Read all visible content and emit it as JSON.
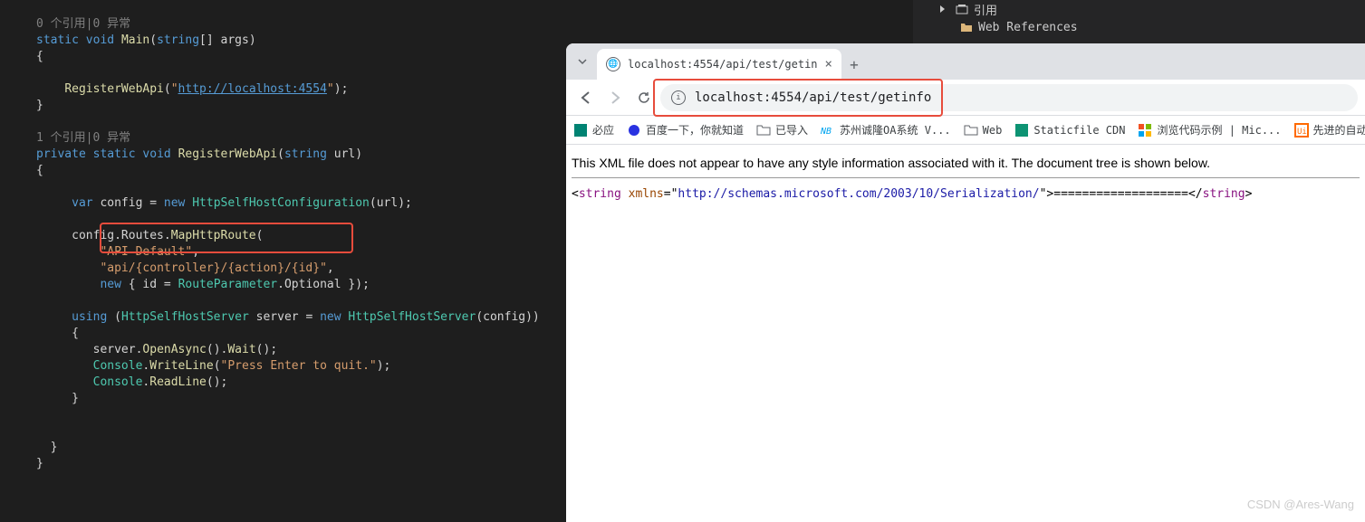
{
  "editor": {
    "ref0": "0 个引用|0 异常",
    "main_sig": {
      "k1": "static",
      "k2": "void",
      "m": "Main",
      "p1": "string",
      "p2": "[] args"
    },
    "reg_call": {
      "m": "RegisterWebApi",
      "url": "http://localhost:4554"
    },
    "ref1": "1 个引用|0 异常",
    "reg_sig": {
      "k1": "private",
      "k2": "static",
      "k3": "void",
      "m": "RegisterWebApi",
      "p1": "string",
      "p2": " url"
    },
    "cfg": {
      "k1": "var",
      "v": "config",
      "k2": "new",
      "cls": "HttpSelfHostConfiguration",
      "arg": "url"
    },
    "route": {
      "m": "MapHttpRoute",
      "name": "\"API Default\"",
      "tmpl": "\"api/{controller}/{action}/{id}\"",
      "k1": "new",
      "id": "id",
      "cls": "RouteParameter",
      "opt": "Optional"
    },
    "using": {
      "k1": "using",
      "cls": "HttpSelfHostServer",
      "v": "server",
      "k2": "new",
      "arg": "config"
    },
    "srv1": {
      "o": "server",
      "m1": "OpenAsync",
      "m2": "Wait"
    },
    "srv2": {
      "c": "Console",
      "m": "WriteLine",
      "s": "\"Press Enter to quit.\""
    },
    "srv3": {
      "c": "Console",
      "m": "ReadLine"
    }
  },
  "solex": {
    "item1": "引用",
    "item2": "Web References"
  },
  "browser": {
    "tab_title": "localhost:4554/api/test/getin",
    "url": "localhost:4554/api/test/getinfo",
    "bookmarks": [
      {
        "label": "必应",
        "color": "#008373"
      },
      {
        "label": "百度一下，你就知道",
        "color": "#2932e1"
      },
      {
        "label": "已导入",
        "color": "#5f6368"
      },
      {
        "label": "苏州诚隆OA系统 V...",
        "color": "#00a4ef"
      },
      {
        "label": "Web",
        "color": "#5f6368"
      },
      {
        "label": "Staticfile CDN",
        "color": "#0d9373"
      },
      {
        "label": "浏览代码示例 | Mic...",
        "color": "#00a4ef"
      },
      {
        "label": "先进的自动化软",
        "color": "#ff6a00"
      }
    ],
    "notice": "This XML file does not appear to have any style information associated with it. The document tree is shown below.",
    "xml": {
      "tag": "string",
      "attr": "xmlns",
      "val": "http://schemas.microsoft.com/2003/10/Serialization/",
      "text": "==================="
    }
  },
  "watermark": "CSDN @Ares-Wang"
}
